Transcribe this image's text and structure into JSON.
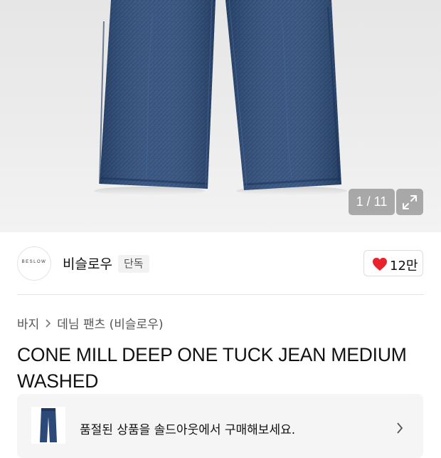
{
  "gallery": {
    "counter": "1 / 11",
    "expand_icon": "expand-icon"
  },
  "brand": {
    "name": "비슬로우",
    "logo_text": "BESLOW",
    "badge": "단독"
  },
  "like": {
    "icon": "heart-icon",
    "count": "12만",
    "color": "#e8232d"
  },
  "breadcrumb": {
    "items": [
      "바지",
      "데님 팬츠 (비슬로우)"
    ]
  },
  "product": {
    "title": "CONE MILL DEEP ONE TUCK JEAN MEDIUM WASHED"
  },
  "soldout_banner": {
    "message": "품절된 상품을 솔드아웃에서 구매해보세요."
  }
}
